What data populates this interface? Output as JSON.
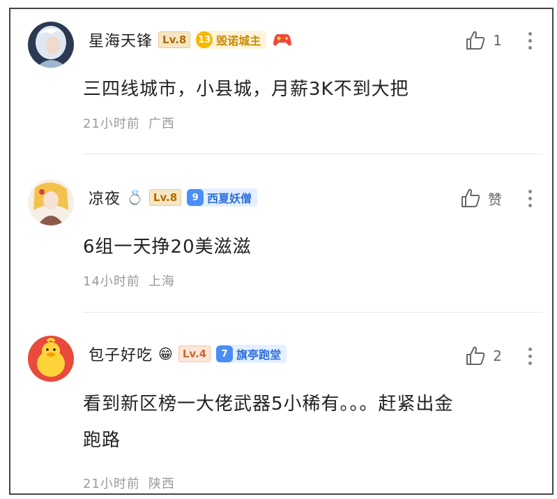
{
  "comments": [
    {
      "username": "星海天锋",
      "level": "Lv.8",
      "title_num": "13",
      "title": "毁诺城主",
      "like_count": "1",
      "text": "三四线城市，小县城，月薪3K不到大把",
      "time": "21小时前",
      "location": "广西"
    },
    {
      "username": "凉夜",
      "level": "Lv.8",
      "title_num": "9",
      "title": "西夏妖僧",
      "like_count": "赞",
      "text": "6组一天挣20美滋滋",
      "time": "14小时前",
      "location": "上海"
    },
    {
      "username": "包子好吃",
      "level": "Lv.4",
      "title_num": "7",
      "title": "旗亭跑堂",
      "like_count": "2",
      "text_line1": "看到新区榜一大佬武器5小稀有。。。赶紧出金",
      "text_line2": "跑路",
      "time": "21小时前",
      "location": "陕西"
    }
  ],
  "icons": {
    "like": "thumbs-up-icon",
    "more": "more-vertical-icon",
    "ring": "ring-emoji",
    "grin": "grinning-emoji",
    "gamepad": "gamepad-icon"
  },
  "colors": {
    "gold_badge": "#f5b700",
    "blue_badge": "#4a8ef5",
    "meta_text": "#999999"
  }
}
